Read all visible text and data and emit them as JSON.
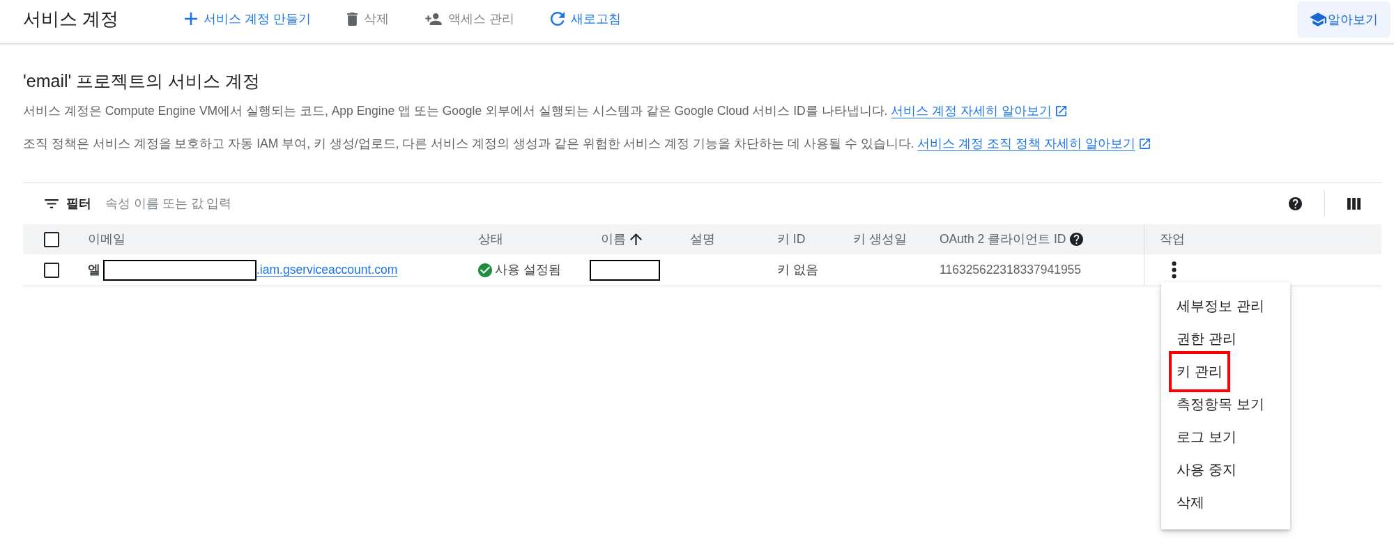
{
  "top_bar": {
    "title": "서비스 계정",
    "actions": [
      {
        "kind": "create",
        "label": "서비스 계정 만들기",
        "disabled": false
      },
      {
        "kind": "delete",
        "label": "삭제",
        "disabled": true
      },
      {
        "kind": "access",
        "label": "액세스 관리",
        "disabled": true
      },
      {
        "kind": "refresh",
        "label": "새로고침",
        "disabled": false
      }
    ],
    "learn_button": {
      "label": "알아보기"
    }
  },
  "intro": {
    "title": "'email' 프로젝트의 서비스 계정",
    "paragraphs": [
      {
        "text": "서비스 계정은 Compute Engine VM에서 실행되는 코드, App Engine 앱 또는 Google 외부에서 실행되는 시스템과 같은 Google Cloud 서비스 ID를 나타냅니다.",
        "link": "서비스 계정 자세히 알아보기"
      },
      {
        "text": "조직 정책은 서비스 계정을 보호하고 자동 IAM 부여, 키 생성/업로드, 다른 서비스 계정의 생성과 같은 위험한 서비스 계정 기능을 차단하는 데 사용될 수 있습니다.",
        "link": "서비스 계정 조직 정책 자세히 알아보기"
      }
    ]
  },
  "filter": {
    "label": "필터",
    "placeholder": "속성 이름 또는 값 입력"
  },
  "table": {
    "select_all": {
      "checked": false
    },
    "columns": [
      {
        "label": "이메일"
      },
      {
        "label": "상태"
      },
      {
        "label": "이름",
        "sorted_ascending": true
      },
      {
        "label": "설명"
      },
      {
        "label": "키 ID"
      },
      {
        "label": "키 생성일"
      },
      {
        "label": "OAuth 2 클라이언트 ID",
        "help": true
      },
      {
        "label": "작업"
      }
    ],
    "rows": [
      {
        "checked": false,
        "email": {
          "prefix": "엘",
          "redacted": true,
          "suffix": ".iam.gserviceaccount.com"
        },
        "status": {
          "kind": "enabled",
          "label": "사용 설정됨"
        },
        "name": {
          "redacted": true
        },
        "key_id": "키 없음",
        "oauth_client_id": "116325622318337941955",
        "menu": {
          "items": [
            {
              "label": "세부정보 관리",
              "highlighted": false
            },
            {
              "label": "권한 관리",
              "highlighted": false
            },
            {
              "label": "키 관리",
              "highlighted": true
            },
            {
              "label": "측정항목 보기",
              "highlighted": false
            },
            {
              "label": "로그 보기",
              "highlighted": false
            },
            {
              "label": "사용 중지",
              "highlighted": false
            },
            {
              "label": "삭제",
              "highlighted": false
            }
          ]
        }
      }
    ]
  }
}
